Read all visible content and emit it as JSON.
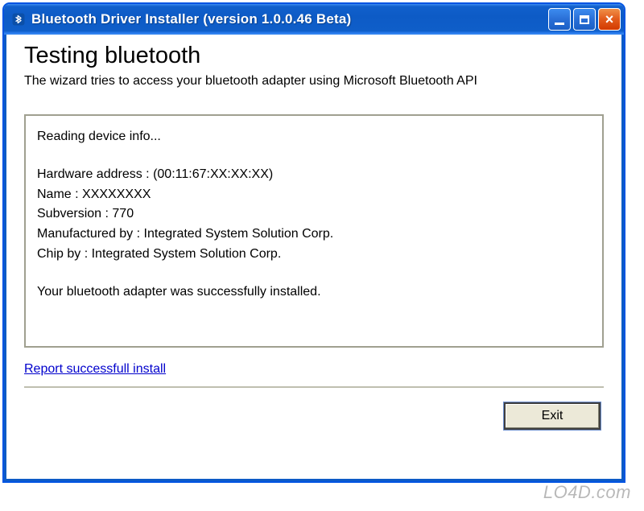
{
  "window": {
    "title": "Bluetooth Driver Installer (version 1.0.0.46 Beta)"
  },
  "header": {
    "title": "Testing bluetooth",
    "subtitle": "The wizard tries to access your bluetooth adapter using Microsoft Bluetooth API"
  },
  "info": {
    "status_line": "Reading device info...",
    "hardware_address_label": "Hardware address :",
    "hardware_address_value": "(00:11:67:XX:XX:XX)",
    "name_label": "Name :",
    "name_value": "XXXXXXXX",
    "subversion_label": "Subversion :",
    "subversion_value": "770",
    "manufactured_label": "Manufactured by :",
    "manufactured_value": "Integrated System Solution Corp.",
    "chip_label": "Chip by :",
    "chip_value": "Integrated System Solution Corp.",
    "result_line": "Your bluetooth adapter was successfully installed."
  },
  "links": {
    "report_label": "Report successfull install"
  },
  "buttons": {
    "exit_label": "Exit"
  },
  "watermark": "LO4D.com"
}
